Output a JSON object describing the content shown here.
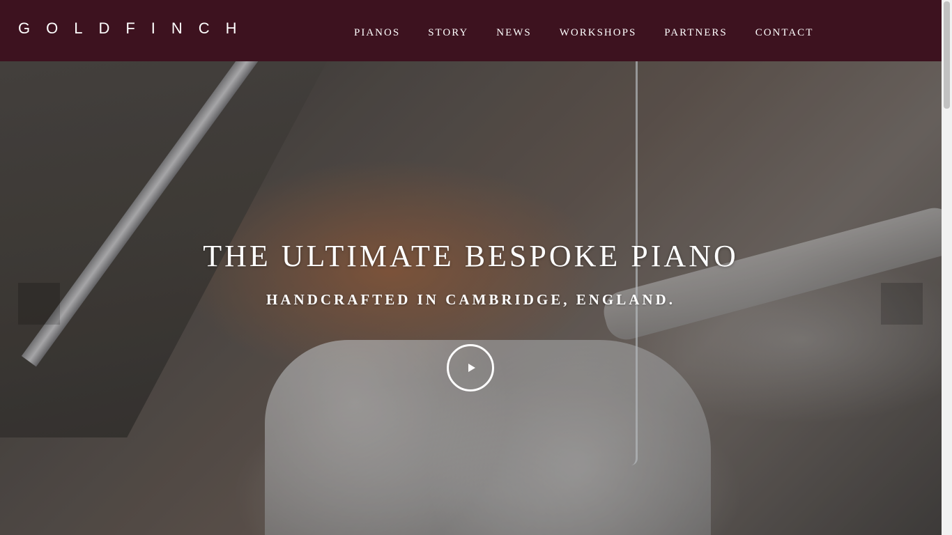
{
  "header": {
    "logo": "GOLDFINCH",
    "background_color": "#3d121f",
    "nav": [
      {
        "label": "PIANOS"
      },
      {
        "label": "STORY"
      },
      {
        "label": "NEWS"
      },
      {
        "label": "WORKSHOPS"
      },
      {
        "label": "PARTNERS"
      },
      {
        "label": "CONTACT"
      }
    ]
  },
  "hero": {
    "title": "THE ULTIMATE BESPOKE PIANO",
    "subtitle": "HANDCRAFTED IN CAMBRIDGE, ENGLAND.",
    "play_icon": "play-circle-icon",
    "prev_icon": "chevron-left-icon",
    "next_icon": "chevron-right-icon"
  }
}
